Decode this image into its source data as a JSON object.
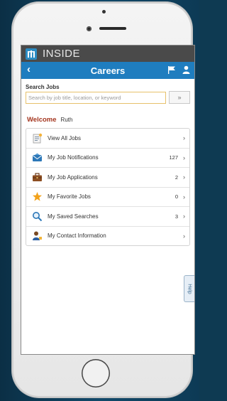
{
  "app": {
    "inside_label": "INSIDE",
    "brand_color": "#1f7dbf"
  },
  "nav": {
    "title": "Careers",
    "back_icon": "chevron-left-icon",
    "flag_icon": "flag-icon",
    "user_icon": "user-icon"
  },
  "search": {
    "label": "Search Jobs",
    "placeholder": "Search by job title, location, or keyword",
    "go_label": "»"
  },
  "welcome": {
    "word": "Welcome",
    "name": "Ruth"
  },
  "menu": [
    {
      "label": "View All Jobs",
      "count": "",
      "icon": "job-list-icon"
    },
    {
      "label": "My Job Notifications",
      "count": "127",
      "icon": "envelope-icon"
    },
    {
      "label": "My Job Applications",
      "count": "2",
      "icon": "briefcase-icon"
    },
    {
      "label": "My Favorite Jobs",
      "count": "0",
      "icon": "star-icon"
    },
    {
      "label": "My Saved Searches",
      "count": "3",
      "icon": "magnifier-icon"
    },
    {
      "label": "My Contact Information",
      "count": "",
      "icon": "contact-icon"
    }
  ],
  "help": {
    "label": "Help"
  }
}
